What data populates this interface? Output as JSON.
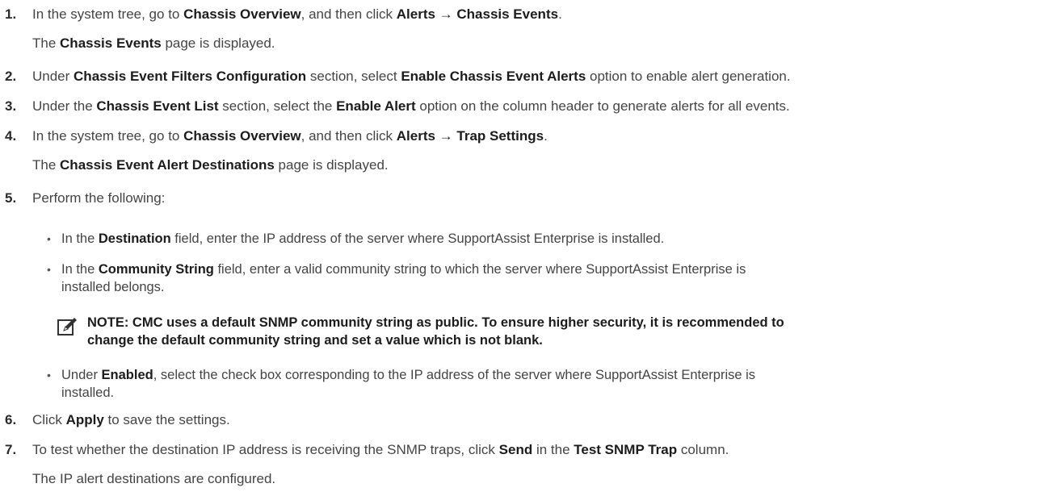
{
  "steps": [
    {
      "num": "1.",
      "t1": "In the system tree, go to ",
      "b1": "Chassis Overview",
      "t2": ", and then click ",
      "b2": "Alerts → Chassis Events",
      "t3": ".",
      "sub_b": "Chassis Events",
      "sub_t": " page is displayed.",
      "sub_pre": "The "
    },
    {
      "num": "2.",
      "t1": "Under ",
      "b1": "Chassis Event Filters Configuration",
      "t2": " section, select ",
      "b2": "Enable Chassis Event Alerts",
      "t3": " option to enable alert generation."
    },
    {
      "num": "3.",
      "t1": "Under the ",
      "b1": "Chassis Event List",
      "t2": " section, select the ",
      "b2": "Enable Alert",
      "t3": " option on the column header to generate alerts for all events."
    },
    {
      "num": "4.",
      "t1": "In the system tree, go to ",
      "b1": "Chassis Overview",
      "t2": ", and then click ",
      "b2": "Alerts → Trap Settings",
      "t3": ".",
      "sub_pre": "The ",
      "sub_b": "Chassis Event Alert Destinations",
      "sub_t": " page is displayed."
    },
    {
      "num": "5.",
      "t1": "Perform the following:"
    },
    {
      "num": "6.",
      "t1": "Click ",
      "b1": "Apply",
      "t2": " to save the settings."
    },
    {
      "num": "7.",
      "t1": "To test whether the destination IP address is receiving the SNMP traps, click ",
      "b1": "Send",
      "t2": " in the ",
      "b2": "Test SNMP Trap",
      "t3": " column.",
      "sub_t": "The IP alert destinations are configured."
    }
  ],
  "bullets": [
    {
      "pre": "In the ",
      "b": "Destination",
      "post": " field, enter the IP address of the server where SupportAssist Enterprise is installed."
    },
    {
      "pre": "In the ",
      "b": "Community String",
      "post": " field, enter a valid community string to which the server where SupportAssist Enterprise is",
      "line2": "installed belongs."
    },
    {
      "pre": "Under ",
      "b": "Enabled",
      "post": ", select the check box corresponding to the IP address of the server where SupportAssist Enterprise is",
      "line2": "installed."
    }
  ],
  "bullet_glyph": "•",
  "note": {
    "icon": "pencil-note-icon",
    "line1": "NOTE: CMC uses a default SNMP community string as public. To ensure higher security, it is recommended to",
    "line2": "change the default community string and set a value which is not blank."
  }
}
